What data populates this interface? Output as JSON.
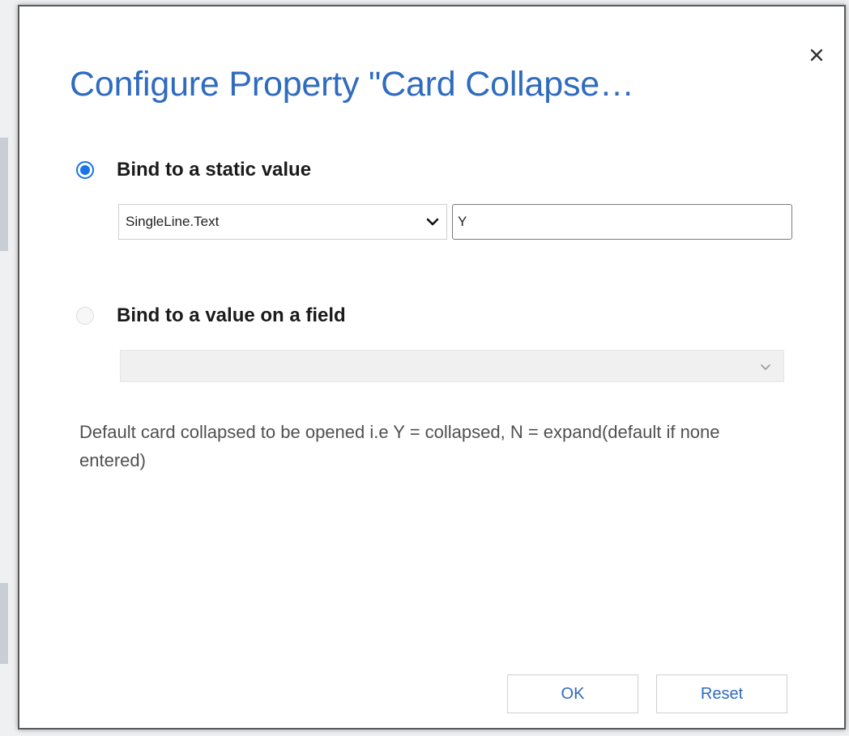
{
  "dialog": {
    "title": "Configure Property \"Card Collapse…",
    "close_icon": "close-icon",
    "options": [
      {
        "label": "Bind to a static value",
        "selected": true
      },
      {
        "label": "Bind to a value on a field",
        "selected": false
      }
    ],
    "static_value": {
      "type_selected": "SingleLine.Text",
      "value": "Y"
    },
    "field_select": {
      "value": ""
    },
    "description": "Default card collapsed to be opened i.e Y = collapsed, N = expand(default if none entered)",
    "buttons": {
      "ok": "OK",
      "reset": "Reset"
    }
  },
  "colors": {
    "title": "#2f6bbf",
    "radio_selected": "#1a73e8",
    "button_text": "#2f6bbf"
  }
}
